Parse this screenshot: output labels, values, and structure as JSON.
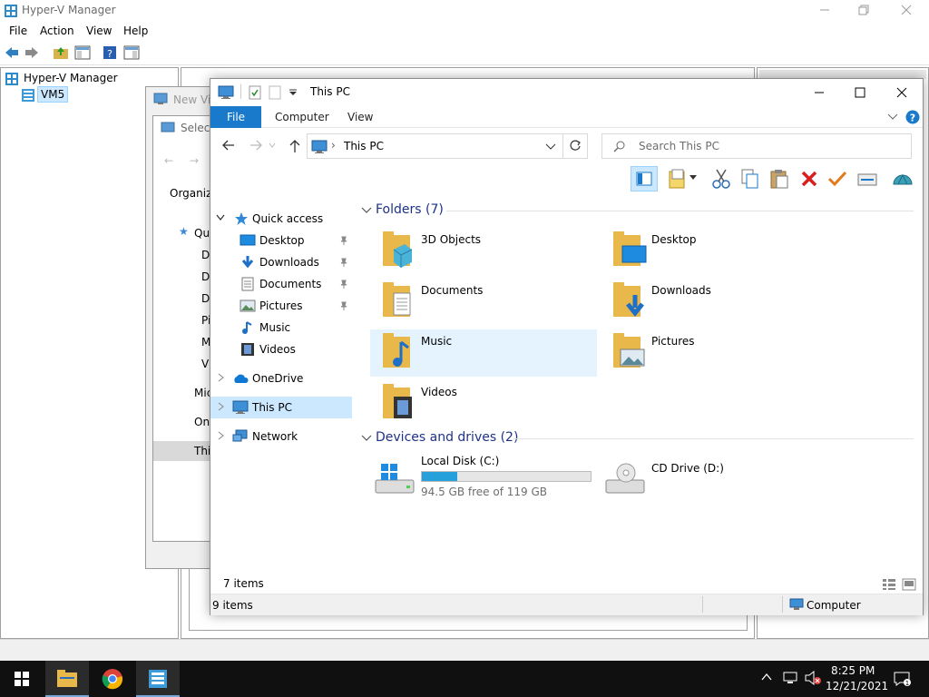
{
  "hyperv": {
    "title": "Hyper-V Manager",
    "menu": [
      "File",
      "Action",
      "View",
      "Help"
    ],
    "tree": {
      "root": "Hyper-V Manager",
      "server": "VM5"
    }
  },
  "wizard": {
    "title_partial": "New Vir",
    "step_partial": "Select",
    "organize_partial": "Organiz",
    "quick_partial": "Qu",
    "items_partial": [
      "D",
      "D",
      "D",
      "Pi",
      "M",
      "Vi"
    ],
    "ms_partial": "Mic",
    "one_partial": "On",
    "this_partial": "Thi"
  },
  "explorer": {
    "title": "This PC",
    "tabs": {
      "file": "File",
      "computer": "Computer",
      "view": "View"
    },
    "address": "This PC",
    "search_placeholder": "Search This PC",
    "nav": {
      "quick_access": "Quick access",
      "items": [
        "Desktop",
        "Downloads",
        "Documents",
        "Pictures",
        "Music",
        "Videos"
      ],
      "onedrive": "OneDrive",
      "thispc": "This PC",
      "network": "Network"
    },
    "folders_header": "Folders (7)",
    "folders": [
      "3D Objects",
      "Desktop",
      "Documents",
      "Downloads",
      "Music",
      "Pictures",
      "Videos"
    ],
    "drives_header": "Devices and drives (2)",
    "drives": [
      {
        "name": "Local Disk (C:)",
        "free": "94.5 GB free of 119 GB",
        "used_fraction": 0.21
      },
      {
        "name": "CD Drive (D:)"
      }
    ],
    "footer_items": "7 items",
    "status_items": "9 items",
    "status_location": "Computer"
  },
  "taskbar": {
    "time": "8:25 PM",
    "date": "12/21/2021"
  },
  "colors": {
    "accent": "#1979ca",
    "folder": "#f5c542",
    "selection": "#cce8ff",
    "drive_bar": "#26a0da"
  }
}
